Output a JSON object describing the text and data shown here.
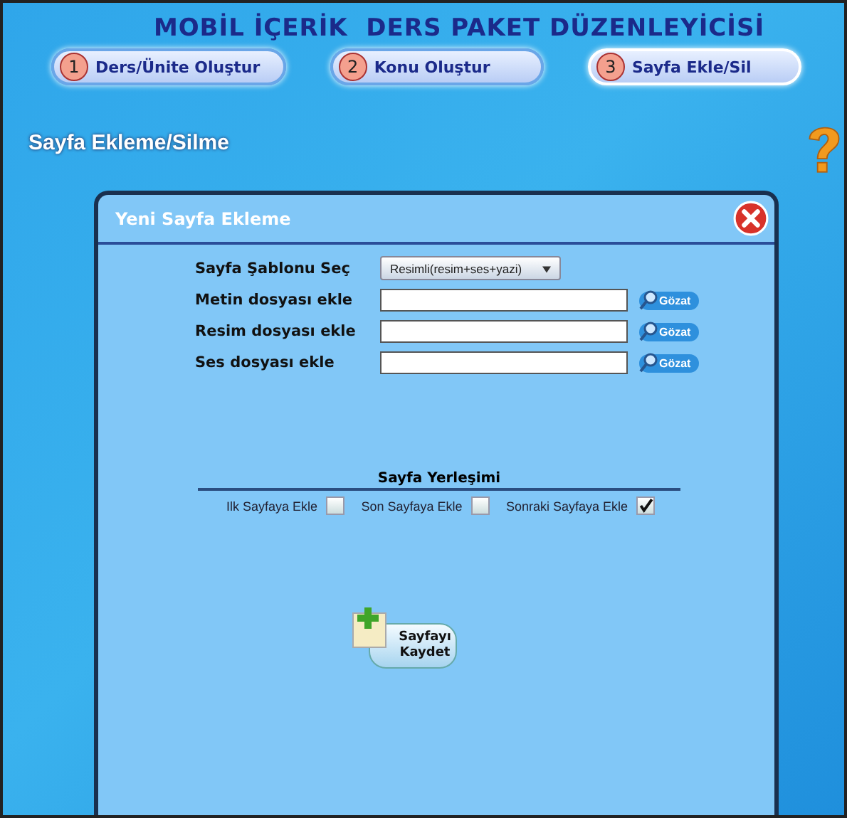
{
  "title": "MOBİL İÇERİK  DERS PAKET DÜZENLEYİCİSİ",
  "steps": [
    {
      "number": "1",
      "label": "Ders/Ünite Oluştur",
      "selected": false
    },
    {
      "number": "2",
      "label": "Konu Oluştur",
      "selected": false
    },
    {
      "number": "3",
      "label": "Sayfa Ekle/Sil",
      "selected": true
    }
  ],
  "section_title": "Sayfa Ekleme/Silme",
  "dialog": {
    "title": "Yeni Sayfa Ekleme",
    "template": {
      "label": "Sayfa Şablonu Seç",
      "value": "Resimli(resim+ses+yazi)"
    },
    "files": [
      {
        "label": "Metin dosyası ekle",
        "button": "Gözat"
      },
      {
        "label": "Resim dosyası ekle",
        "button": "Gözat"
      },
      {
        "label": "Ses dosyası ekle",
        "button": "Gözat"
      }
    ],
    "placement": {
      "title": "Sayfa Yerleşimi",
      "options": [
        {
          "label": "Ilk Sayfaya Ekle",
          "checked": false
        },
        {
          "label": "Son Sayfaya Ekle",
          "checked": false
        },
        {
          "label": "Sonraki Sayfaya Ekle",
          "checked": true
        }
      ]
    },
    "save": "Sayfayı Kaydet"
  }
}
